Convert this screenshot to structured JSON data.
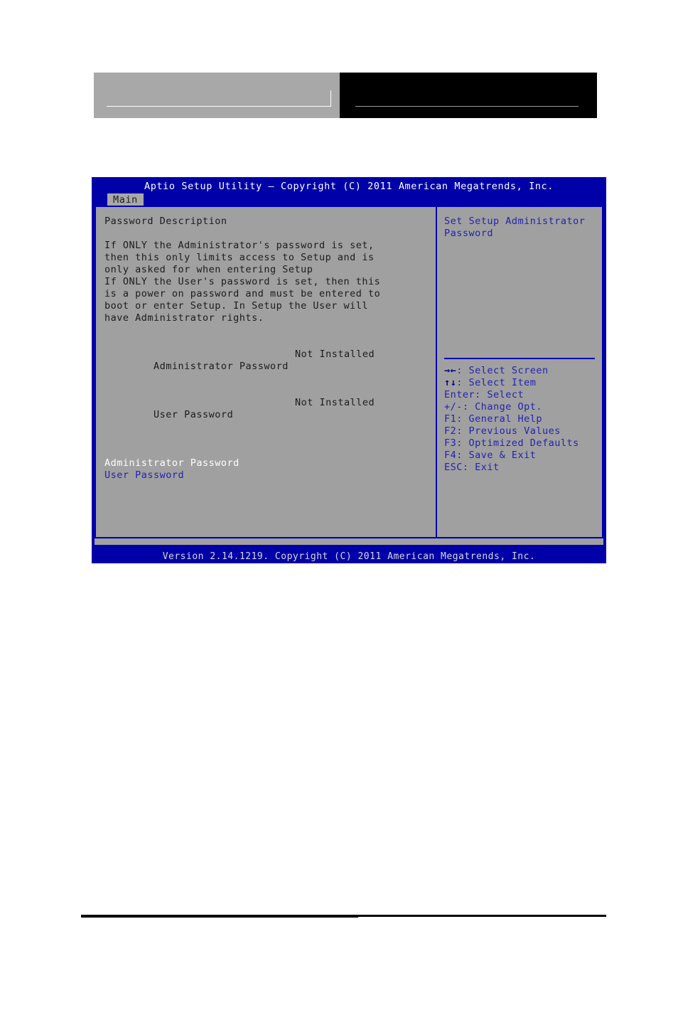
{
  "page": {
    "header_blocks": [
      {
        "name": "left-gray-banner",
        "fill": "#a8a8a8"
      },
      {
        "name": "right-black-banner",
        "fill": "#000000"
      }
    ]
  },
  "bios": {
    "title": "Aptio Setup Utility – Copyright (C) 2011 American Megatrends, Inc.",
    "tabs": [
      {
        "label": "Main",
        "active": true
      }
    ],
    "colors": {
      "titlebar": "#0000a8",
      "panel": "#a0a0a0",
      "border": "#0000b4",
      "link": "#2222b4",
      "selected": "#ffffff",
      "text": "#1c1c1c"
    },
    "main": {
      "section_title": "Password Description",
      "description": [
        "If ONLY the Administrator's password is set,",
        "then this only limits access to Setup and is",
        "only asked for when entering Setup",
        "If ONLY the User's password is set, then this",
        "is a power on password and must be entered to",
        "boot or enter Setup. In Setup the User will",
        "have Administrator rights."
      ],
      "status_rows": [
        {
          "label": "Administrator Password",
          "value": "Not Installed"
        },
        {
          "label": "User Password",
          "value": "Not Installed"
        }
      ],
      "menu_items": [
        {
          "label": "Administrator Password",
          "selected": true
        },
        {
          "label": "User Password",
          "selected": false
        }
      ]
    },
    "help": {
      "text": [
        "Set Setup Administrator",
        "Password"
      ],
      "keys": [
        {
          "glyph": "→←",
          "label": ": Select Screen"
        },
        {
          "glyph": "↑↓",
          "label": ": Select Item"
        },
        {
          "glyph": "",
          "label": "Enter: Select"
        },
        {
          "glyph": "",
          "label": "+/-: Change Opt."
        },
        {
          "glyph": "",
          "label": "F1: General Help"
        },
        {
          "glyph": "",
          "label": "F2: Previous Values"
        },
        {
          "glyph": "",
          "label": "F3: Optimized Defaults"
        },
        {
          "glyph": "",
          "label": "F4: Save & Exit"
        },
        {
          "glyph": "",
          "label": "ESC: Exit"
        }
      ]
    },
    "footer": "Version 2.14.1219. Copyright (C) 2011 American Megatrends, Inc."
  }
}
